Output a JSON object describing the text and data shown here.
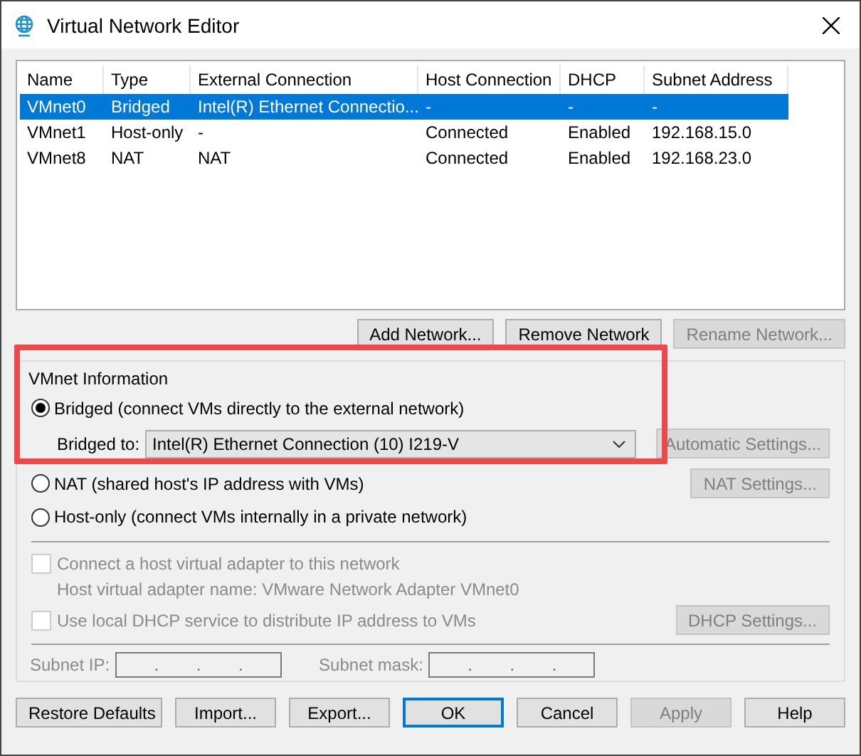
{
  "window": {
    "title": "Virtual Network Editor"
  },
  "table": {
    "columns": [
      "Name",
      "Type",
      "External Connection",
      "Host Connection",
      "DHCP",
      "Subnet Address"
    ],
    "rows": [
      {
        "selected": true,
        "cells": [
          "VMnet0",
          "Bridged",
          "Intel(R) Ethernet Connectio...",
          "-",
          "-",
          "-"
        ]
      },
      {
        "selected": false,
        "cells": [
          "VMnet1",
          "Host-only",
          "-",
          "Connected",
          "Enabled",
          "192.168.15.0"
        ]
      },
      {
        "selected": false,
        "cells": [
          "VMnet8",
          "NAT",
          "NAT",
          "Connected",
          "Enabled",
          "192.168.23.0"
        ]
      }
    ]
  },
  "network_buttons": [
    {
      "label": "Add Network...",
      "disabled": false
    },
    {
      "label": "Remove Network",
      "disabled": false
    },
    {
      "label": "Rename Network...",
      "disabled": true
    }
  ],
  "vmnet_info": {
    "title": "VMnet Information",
    "bridged": {
      "label": "Bridged (connect VMs directly to the external network)",
      "selected": true
    },
    "bridged_to": {
      "label": "Bridged to:",
      "value": "Intel(R) Ethernet Connection (10) I219-V"
    },
    "automatic_settings": {
      "label": "Automatic Settings...",
      "disabled": true
    },
    "nat": {
      "label": "NAT (shared host's IP address with VMs)",
      "selected": false
    },
    "nat_settings": {
      "label": "NAT Settings...",
      "disabled": true
    },
    "host_only": {
      "label": "Host-only (connect VMs internally in a private network)",
      "selected": false
    },
    "connect_adapter": {
      "label": "Connect a host virtual adapter to this network",
      "checked": false,
      "disabled": true
    },
    "adapter_name": "Host virtual adapter name: VMware Network Adapter VMnet0",
    "use_dhcp": {
      "label": "Use local DHCP service to distribute IP address to VMs",
      "checked": false,
      "disabled": true
    },
    "dhcp_settings": {
      "label": "DHCP Settings...",
      "disabled": true
    },
    "subnet_ip": {
      "label": "Subnet IP:",
      "dots": [
        ".",
        ".",
        "."
      ]
    },
    "subnet_mask": {
      "label": "Subnet mask:",
      "dots": [
        ".",
        ".",
        "."
      ]
    }
  },
  "buttons": [
    {
      "label": "Restore Defaults",
      "disabled": false,
      "default": false
    },
    {
      "label": "Import...",
      "disabled": false,
      "default": false
    },
    {
      "label": "Export...",
      "disabled": false,
      "default": false
    },
    {
      "label": "OK",
      "disabled": false,
      "default": true
    },
    {
      "label": "Cancel",
      "disabled": false,
      "default": false
    },
    {
      "label": "Apply",
      "disabled": true,
      "default": false
    },
    {
      "label": "Help",
      "disabled": false,
      "default": false
    }
  ],
  "highlight": {
    "color": "#f0474a"
  }
}
